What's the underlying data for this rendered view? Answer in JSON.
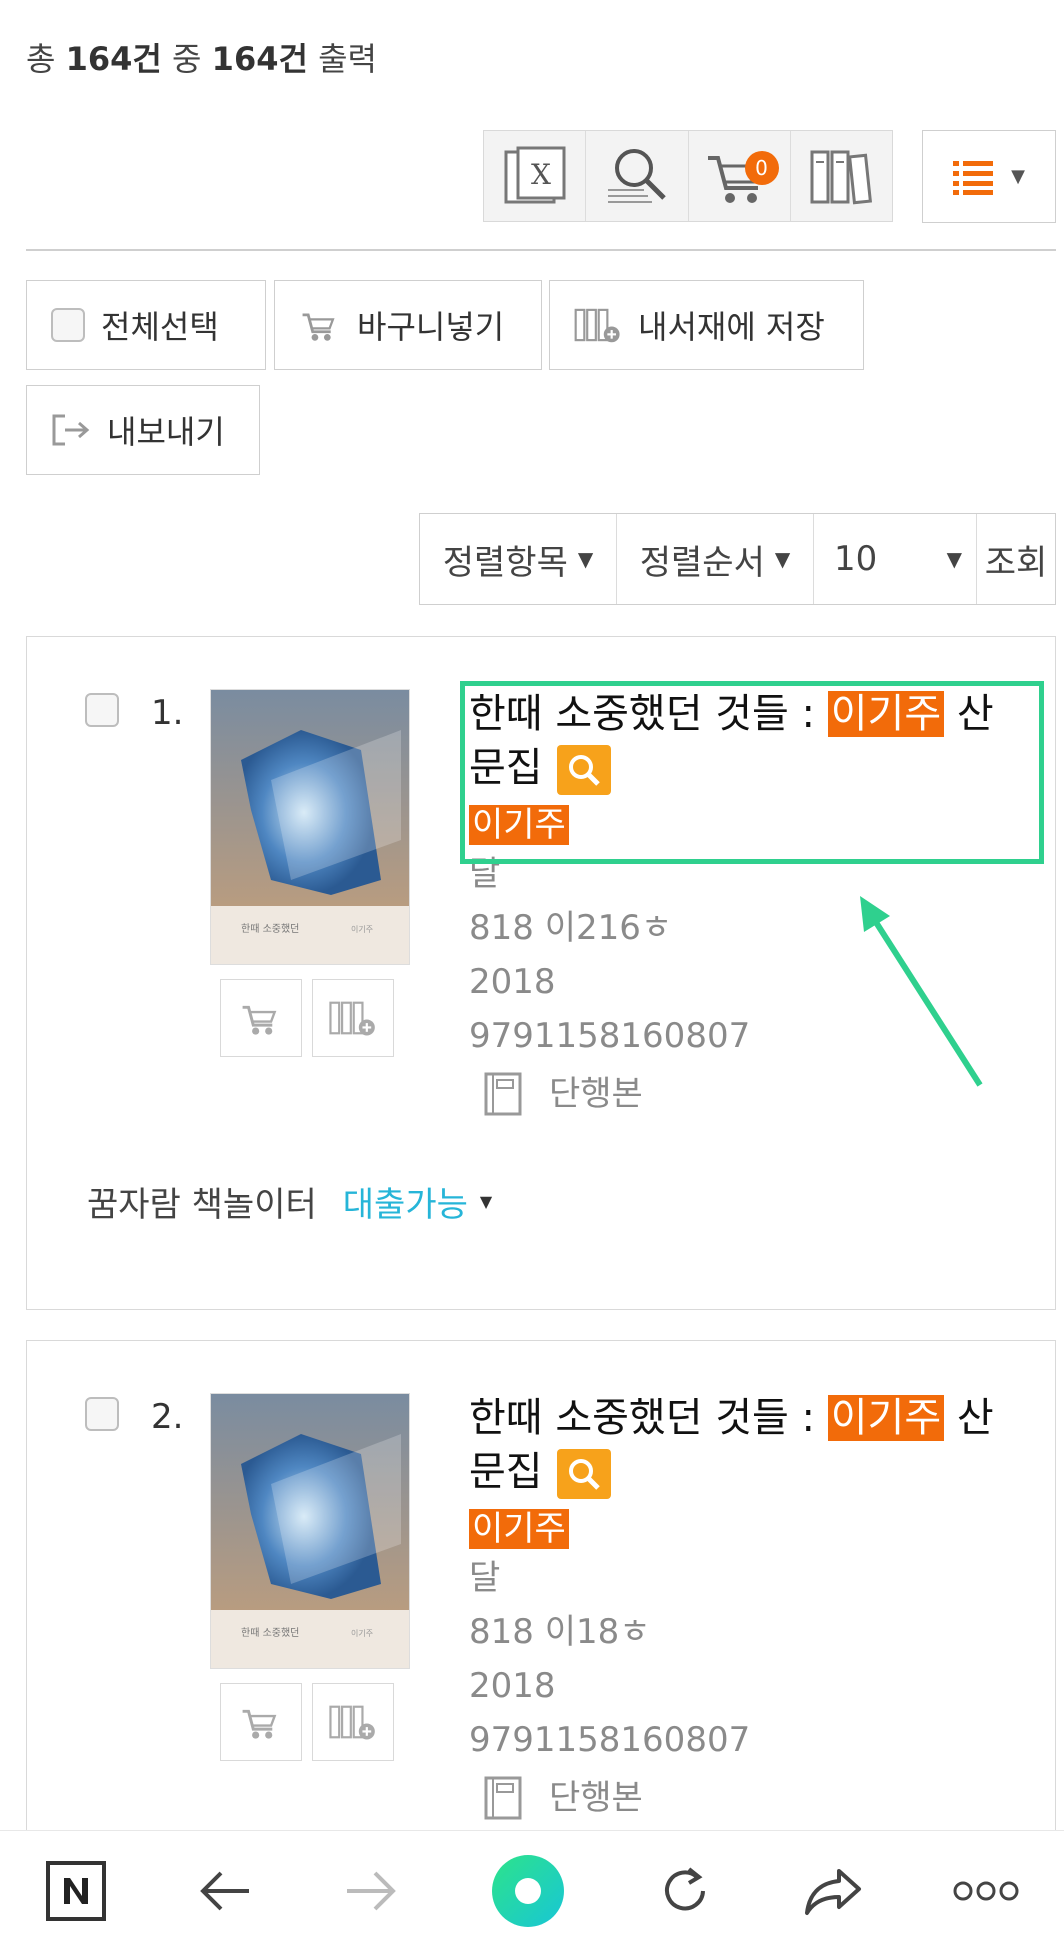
{
  "summary": {
    "prefix": "총 ",
    "total": "164건",
    "mid": " 중 ",
    "shown": "164건",
    "suffix": " 출력"
  },
  "toolbar": {
    "cart_count": "0"
  },
  "actions": {
    "select_all": "전체선택",
    "add_cart": "바구니넣기",
    "save_shelf": "내서재에 저장",
    "export": "내보내기"
  },
  "sort": {
    "field": "정렬항목",
    "order": "정렬순서",
    "page_size": "10",
    "search_btn": "조회"
  },
  "colors": {
    "accent": "#f26b0a",
    "highlight_box": "#2fd08e",
    "available": "#26b5d8"
  },
  "results": [
    {
      "index": "1.",
      "title_before": "한때 소중했던 것들 : ",
      "title_highlight": "이기주",
      "title_after": " 산문집",
      "author": "이기주",
      "publisher": "달",
      "call_number": "818 이216ㅎ",
      "year": "2018",
      "isbn": "9791158160807",
      "format": "단행본",
      "library": "꿈자람 책놀이터",
      "status": "대출가능"
    },
    {
      "index": "2.",
      "title_before": "한때 소중했던 것들 : ",
      "title_highlight": "이기주",
      "title_after": " 산문집",
      "author": "이기주",
      "publisher": "달",
      "call_number": "818 이18ㅎ",
      "year": "2018",
      "isbn": "9791158160807",
      "format": "단행본"
    }
  ],
  "browser": {
    "icons": [
      "naver-icon",
      "back-icon",
      "forward-icon",
      "home-icon",
      "reload-icon",
      "share-icon",
      "more-icon"
    ]
  }
}
